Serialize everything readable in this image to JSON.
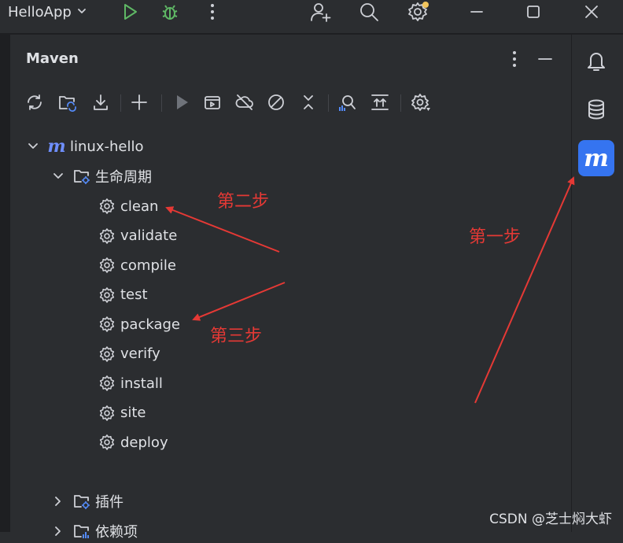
{
  "titlebar": {
    "app_name": "HelloApp",
    "icons": [
      "chevron-down-icon",
      "run-icon",
      "debug-icon",
      "more-vert-icon",
      "add-user-icon",
      "search-icon",
      "settings-icon",
      "minimize-icon",
      "maximize-icon",
      "close-icon"
    ]
  },
  "panel": {
    "title": "Maven",
    "header_icons": [
      "more-vert-icon",
      "hide-icon"
    ]
  },
  "toolbar": {
    "icons": [
      "reload-icon",
      "reload-folder-icon",
      "download-icon",
      "add-icon",
      "run-icon",
      "run-config-icon",
      "offline-icon",
      "skip-tests-icon",
      "collapse-icon",
      "analyze-icon",
      "toggle-icon",
      "settings-icon"
    ]
  },
  "tree": {
    "project": "linux-hello",
    "lifecycle": "生命周期",
    "goals": [
      "clean",
      "validate",
      "compile",
      "test",
      "package",
      "verify",
      "install",
      "site",
      "deploy"
    ],
    "plugins": "插件",
    "dependencies": "依赖项"
  },
  "rightbar": {
    "icons": [
      "notifications-icon",
      "database-icon",
      "maven-icon"
    ],
    "active": "maven-icon",
    "maven_glyph": "m"
  },
  "annotations": {
    "step1": "第一步",
    "step2": "第二步",
    "step3": "第三步",
    "color": "#e53935"
  },
  "watermark": "CSDN @芝士焖大虾"
}
